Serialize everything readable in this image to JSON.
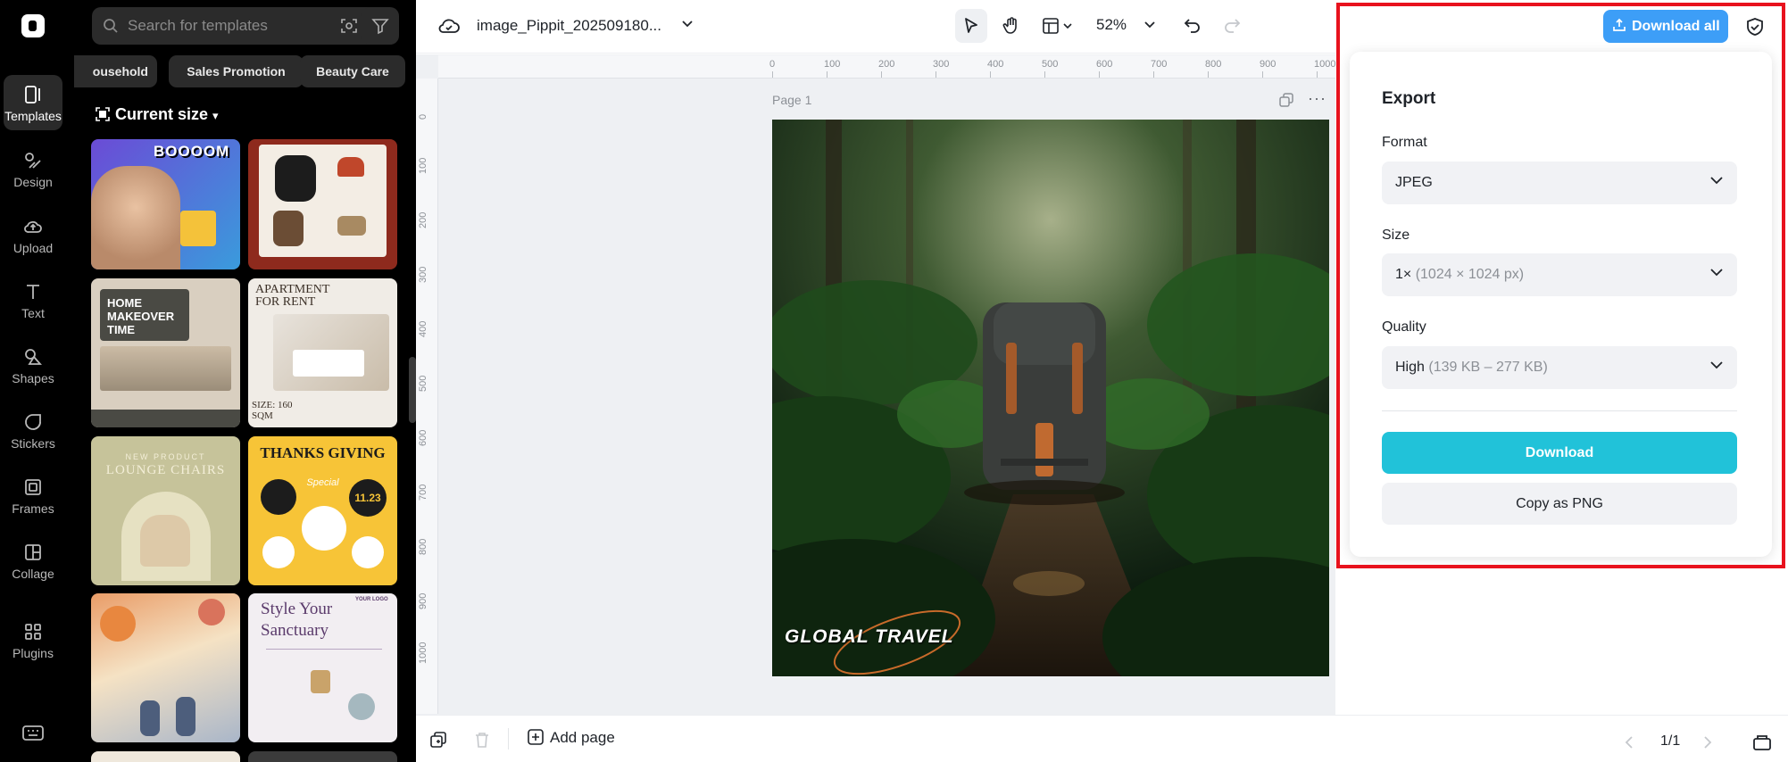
{
  "rail": {
    "items": [
      {
        "label": "Templates",
        "icon": "templates-icon"
      },
      {
        "label": "Design",
        "icon": "design-icon"
      },
      {
        "label": "Upload",
        "icon": "upload-icon"
      },
      {
        "label": "Text",
        "icon": "text-icon"
      },
      {
        "label": "Shapes",
        "icon": "shapes-icon"
      },
      {
        "label": "Stickers",
        "icon": "stickers-icon"
      },
      {
        "label": "Frames",
        "icon": "frames-icon"
      },
      {
        "label": "Collage",
        "icon": "collage-icon"
      },
      {
        "label": "Plugins",
        "icon": "plugins-icon"
      }
    ]
  },
  "panel": {
    "search_placeholder": "Search for templates",
    "chips": [
      "ousehold",
      "Sales Promotion",
      "Beauty Care"
    ],
    "current_size": "Current size",
    "thumbs": {
      "t1_text": "BOOOOM",
      "t3_title": "HOME MAKEOVER TIME",
      "t4_title": "APARTMENT FOR RENT",
      "t4_size": "SIZE: 160 SQM",
      "t5_sub": "NEW PRODUCT",
      "t5_title": "LOUNGE CHAIRS",
      "t6_title": "THANKS GIVING",
      "t6_sub": "Special",
      "t6_date": "11.23",
      "t8_title": "Style Your Sanctuary",
      "t8_logo": "YOUR LOGO"
    }
  },
  "toolbar": {
    "filename": "image_Pippit_202509180...",
    "zoom": "52%"
  },
  "canvas": {
    "page_label": "Page 1",
    "ruler_h": [
      "0",
      "100",
      "200",
      "300",
      "400",
      "500",
      "600",
      "700",
      "800",
      "900",
      "1000"
    ],
    "ruler_v": [
      "0",
      "100",
      "200",
      "300",
      "400",
      "500",
      "600",
      "700",
      "800",
      "900",
      "1000"
    ],
    "image_text": "GLOBAL TRAVEL"
  },
  "bottombar": {
    "add_page": "Add page",
    "pager": "1/1"
  },
  "export": {
    "download_all": "Download all",
    "title": "Export",
    "format_label": "Format",
    "format_value": "JPEG",
    "size_label": "Size",
    "size_value": "1×",
    "size_detail": "(1024 × 1024 px)",
    "quality_label": "Quality",
    "quality_value": "High",
    "quality_detail": "(139 KB – 277 KB)",
    "download": "Download",
    "copy_png": "Copy as PNG"
  },
  "colors": {
    "accent_teal": "#21c2d9",
    "accent_blue": "#3d9ef7",
    "highlight_red": "#e8121d"
  }
}
